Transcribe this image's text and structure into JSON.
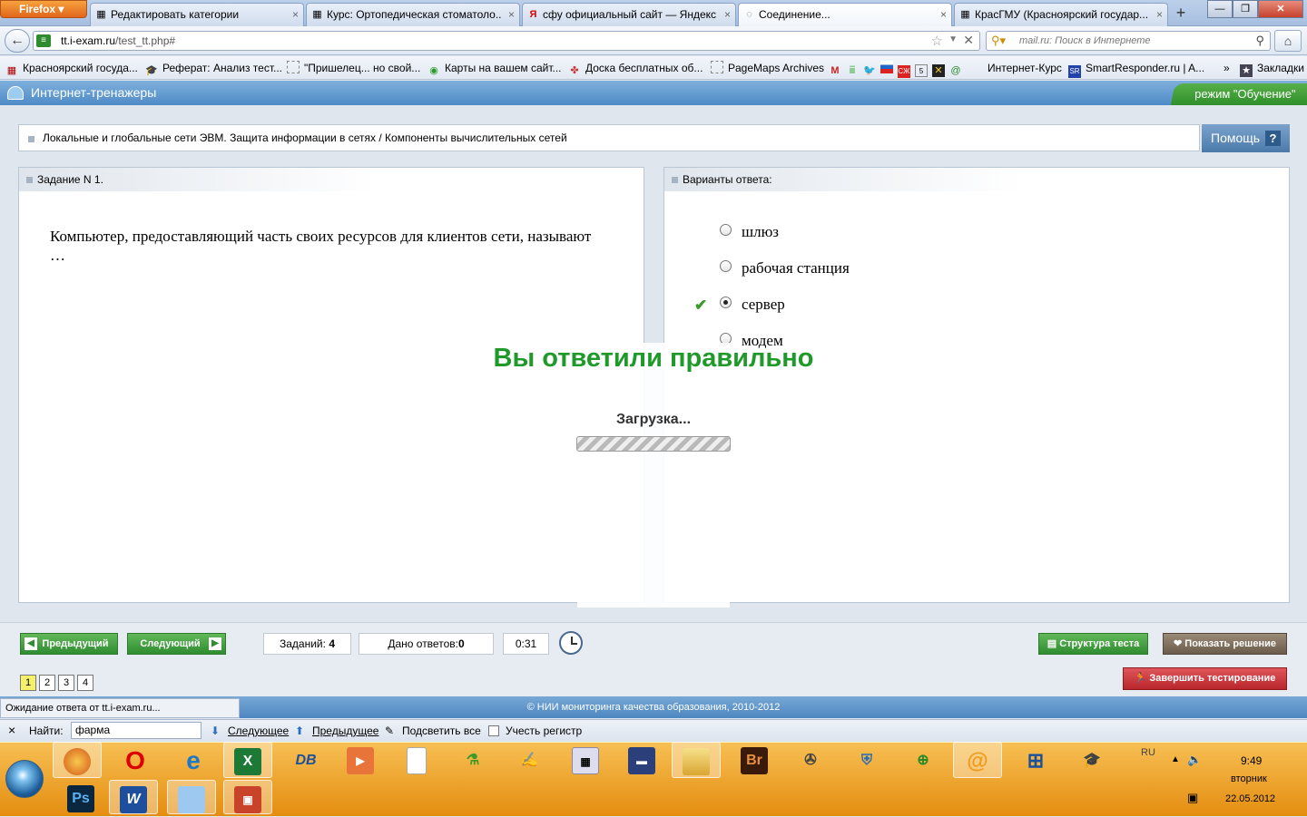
{
  "browser": {
    "menu_label": "Firefox",
    "tabs": [
      {
        "label": "Редактировать категории",
        "icon": "chess-favicon",
        "active": false
      },
      {
        "label": "Курс: Ортопедическая стоматоло...",
        "icon": "chess-favicon",
        "active": false
      },
      {
        "label": "сфу официальный сайт — Яндекс...",
        "icon": "yandex-favicon",
        "active": false
      },
      {
        "label": "Соединение...",
        "icon": "loading-favicon",
        "active": true
      },
      {
        "label": "КрасГМУ (Красноярский государ...",
        "icon": "chess-favicon",
        "active": false
      }
    ],
    "url_domain": "tt.i-exam.ru",
    "url_path": "/test_tt.php#",
    "search_placeholder": "mail.ru: Поиск в Интернете",
    "bookmarks": [
      {
        "label": "Красноярский госуда..."
      },
      {
        "label": "Реферат: Анализ тест..."
      },
      {
        "label": "\"Пришелец... но свой..."
      },
      {
        "label": "Карты на вашем сайт..."
      },
      {
        "label": "Доска бесплатных об..."
      },
      {
        "label": "PageMaps Archives"
      },
      {
        "label": "Интернет-Курс"
      },
      {
        "label": "SmartResponder.ru | A..."
      }
    ],
    "bookmarks_more": "»",
    "bookmarks_menu": "Закладки"
  },
  "app": {
    "title": "Интернет-тренажеры",
    "mode": "режим \"Обучение\"",
    "breadcrumb": "Локальные и глобальные сети ЭВМ. Защита информации в сетях / Компоненты вычислительных сетей",
    "help_label": "Помощь",
    "help_icon": "?"
  },
  "question": {
    "header": "Задание N 1.",
    "text": "Компьютер, предоставляющий часть своих ресурсов для клиентов сети, называют …"
  },
  "answers": {
    "header": "Варианты ответа:",
    "options": [
      {
        "label": "шлюз",
        "selected": false
      },
      {
        "label": "рабочая станция",
        "selected": false
      },
      {
        "label": "сервер",
        "selected": true,
        "correct_mark": "✔"
      },
      {
        "label": "модем",
        "selected": false
      }
    ]
  },
  "feedback": {
    "result": "Вы ответили правильно",
    "loading": "Загрузка..."
  },
  "controls": {
    "prev_label": "Предыдущий",
    "next_label": "Следующий",
    "tasks_label": "Заданий:",
    "tasks_count": "4",
    "answered_label": "Дано ответов:",
    "answered_count": "0",
    "timer": "0:31",
    "structure_label": "Структура теста",
    "solution_label": "Показать решение",
    "finish_label": "Завершить тестирование",
    "pages": [
      "1",
      "2",
      "3",
      "4"
    ],
    "current_page": "1"
  },
  "footer": {
    "copyright": "© НИИ мониторинга качества образования, 2010-2012",
    "status": "Ожидание ответа от tt.i-exam.ru..."
  },
  "findbar": {
    "close": "×",
    "label": "Найти:",
    "value": "фарма",
    "next": "Следующее",
    "prev": "Предыдущее",
    "highlight": "Подсветить все",
    "match_case": "Учесть регистр"
  },
  "taskbar": {
    "lang": "RU",
    "time": "9:49",
    "day": "вторник",
    "date": "22.05.2012",
    "apps": [
      "firefox-icon",
      "opera-icon",
      "ie-icon",
      "excel-icon",
      "db-icon",
      "media-player-icon",
      "document-icon",
      "lab-icon",
      "paint-icon",
      "calculator-icon",
      "floppy-icon",
      "folder-icon",
      "bridge-icon",
      "scanner-icon",
      "security-icon",
      "network-icon",
      "mail-icon",
      "grid-icon",
      "graduation-icon"
    ],
    "bridge_label": "Br",
    "ps_label": "Ps",
    "word_label": "W",
    "db_label": "DB"
  },
  "colors": {
    "correct_green": "#1f9a2a",
    "header_blue": "#4e8bc6",
    "taskbar_orange": "#e48d10",
    "finish_red": "#b8262c"
  }
}
